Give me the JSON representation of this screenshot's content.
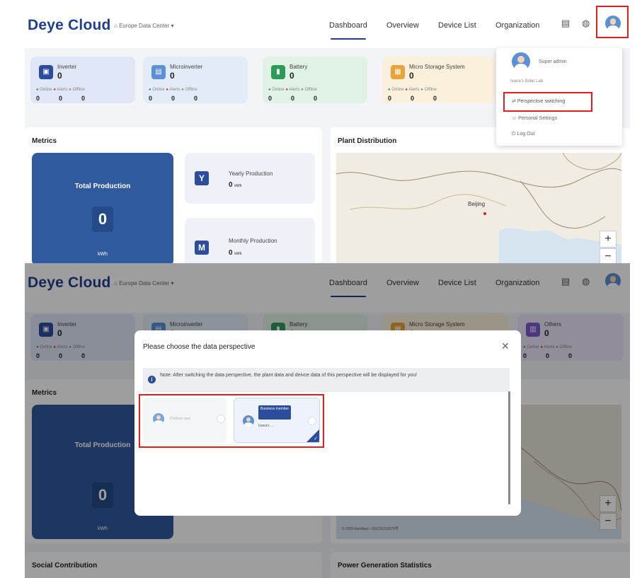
{
  "header": {
    "logo": "Deye Cloud",
    "region": "Europe Data Center",
    "region_icon": "building-icon",
    "nav": [
      "Dashboard",
      "Overview",
      "Device List",
      "Organization"
    ]
  },
  "device_cards": [
    {
      "name": "Inverter",
      "count": "0",
      "statuses": [
        "Online",
        "Alerts",
        "Offline"
      ],
      "values": [
        "0",
        "0",
        "0"
      ],
      "icon_color": "#2c4d9c",
      "bg": "#dfe6f5"
    },
    {
      "name": "Microinverter",
      "count": "0",
      "statuses": [
        "Online",
        "Alerts",
        "Offline"
      ],
      "values": [
        "0",
        "0",
        "0"
      ],
      "icon_color": "#5b8fd6",
      "bg": "#e1ecf8"
    },
    {
      "name": "Battery",
      "count": "0",
      "statuses": [
        "Online",
        "Alerts",
        "Offline"
      ],
      "values": [
        "0",
        "0",
        "0"
      ],
      "icon_color": "#2e9a57",
      "bg": "#e0f1e6"
    },
    {
      "name": "Micro Storage System",
      "count": "0",
      "statuses": [
        "Online",
        "Alerts",
        "Offline"
      ],
      "values": [
        "0",
        "0",
        "0"
      ],
      "icon_color": "#e8a33b",
      "bg": "#faf0dc"
    },
    {
      "name": "Others",
      "count": "0",
      "statuses": [
        "Online",
        "Alerts",
        "Offline"
      ],
      "values": [
        "0",
        "0",
        "0"
      ],
      "icon_color": "#7a5bd0",
      "bg": "#ebe5f8"
    }
  ],
  "metrics": {
    "title": "Metrics",
    "total_label": "Total Production",
    "total_value": "0",
    "total_unit": "kWh",
    "yearly_label": "Yearly Production",
    "yearly_letter": "Y",
    "yearly_value": "0",
    "yearly_unit": "kWh",
    "monthly_label": "Monthly Production",
    "monthly_letter": "M",
    "monthly_value": "0",
    "monthly_unit": "kWh"
  },
  "plant_distribution": {
    "title": "Plant Distribution",
    "city": "Beijing",
    "zoom_in": "+",
    "zoom_out": "−"
  },
  "user_menu": {
    "role": "Super admin",
    "org": "Ivana's Solar Lab",
    "items": [
      "Perspective switching",
      "Personal Settings",
      "Log Out"
    ]
  },
  "modal": {
    "title": "Please choose the data perspective",
    "close": "✕",
    "note": "Note: After switching the data perspective, the plant data and deivce data of this perspective will be displayed for you!",
    "options": [
      {
        "label": "Platform user",
        "badge": "",
        "sub": ""
      },
      {
        "label": "",
        "badge": "Business member",
        "sub": "Ivana's ..."
      }
    ]
  },
  "bottom_sections": {
    "social": "Social Contribution",
    "power": "Power Generation Statistics"
  },
  "map_attribution": "© 2025 AutoNavi - GS(2021)6375号",
  "colors": {
    "brand": "#1f3f8f",
    "primary": "#2c4d9c",
    "highlight": "#e02020",
    "online": "#2e9a57",
    "alert": "#d93025"
  }
}
